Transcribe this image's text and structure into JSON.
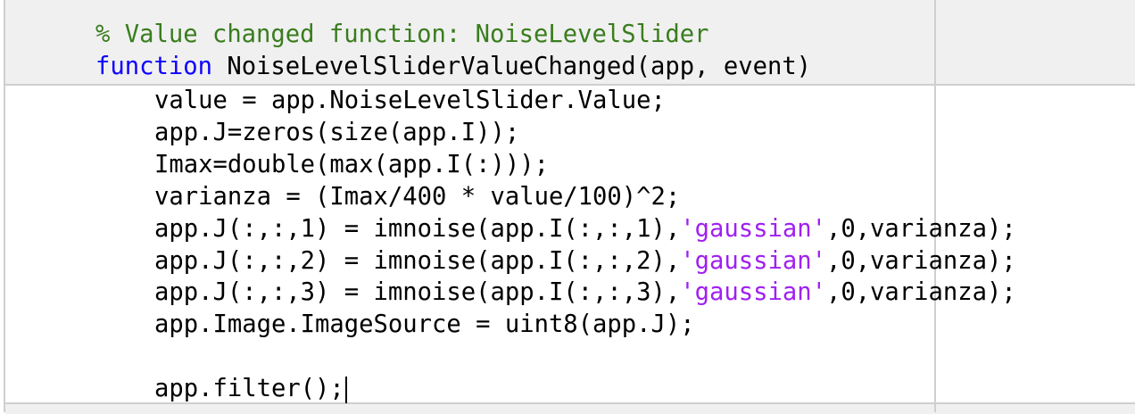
{
  "header": {
    "comment": "% Value changed function: NoiseLevelSlider",
    "keyword": "function",
    "signature": " NoiseLevelSliderValueChanged(app, event)"
  },
  "body": [
    {
      "pre": "value = app.NoiseLevelSlider.Value;"
    },
    {
      "pre": "app.J=zeros(size(app.I));"
    },
    {
      "pre": "Imax=double(max(app.I(:)));"
    },
    {
      "pre": "varianza = (Imax/400 * value/100)^2;"
    },
    {
      "pre": "app.J(:,:,1) = imnoise(app.I(:,:,1),",
      "str": "'gaussian'",
      "post": ",0,varianza);"
    },
    {
      "pre": "app.J(:,:,2) = imnoise(app.I(:,:,2),",
      "str": "'gaussian'",
      "post": ",0,varianza);"
    },
    {
      "pre": "app.J(:,:,3) = imnoise(app.I(:,:,3),",
      "str": "'gaussian'",
      "post": ",0,varianza);"
    },
    {
      "pre": "app.Image.ImageSource = uint8(app.J);"
    }
  ],
  "last_line": "app.filter();"
}
